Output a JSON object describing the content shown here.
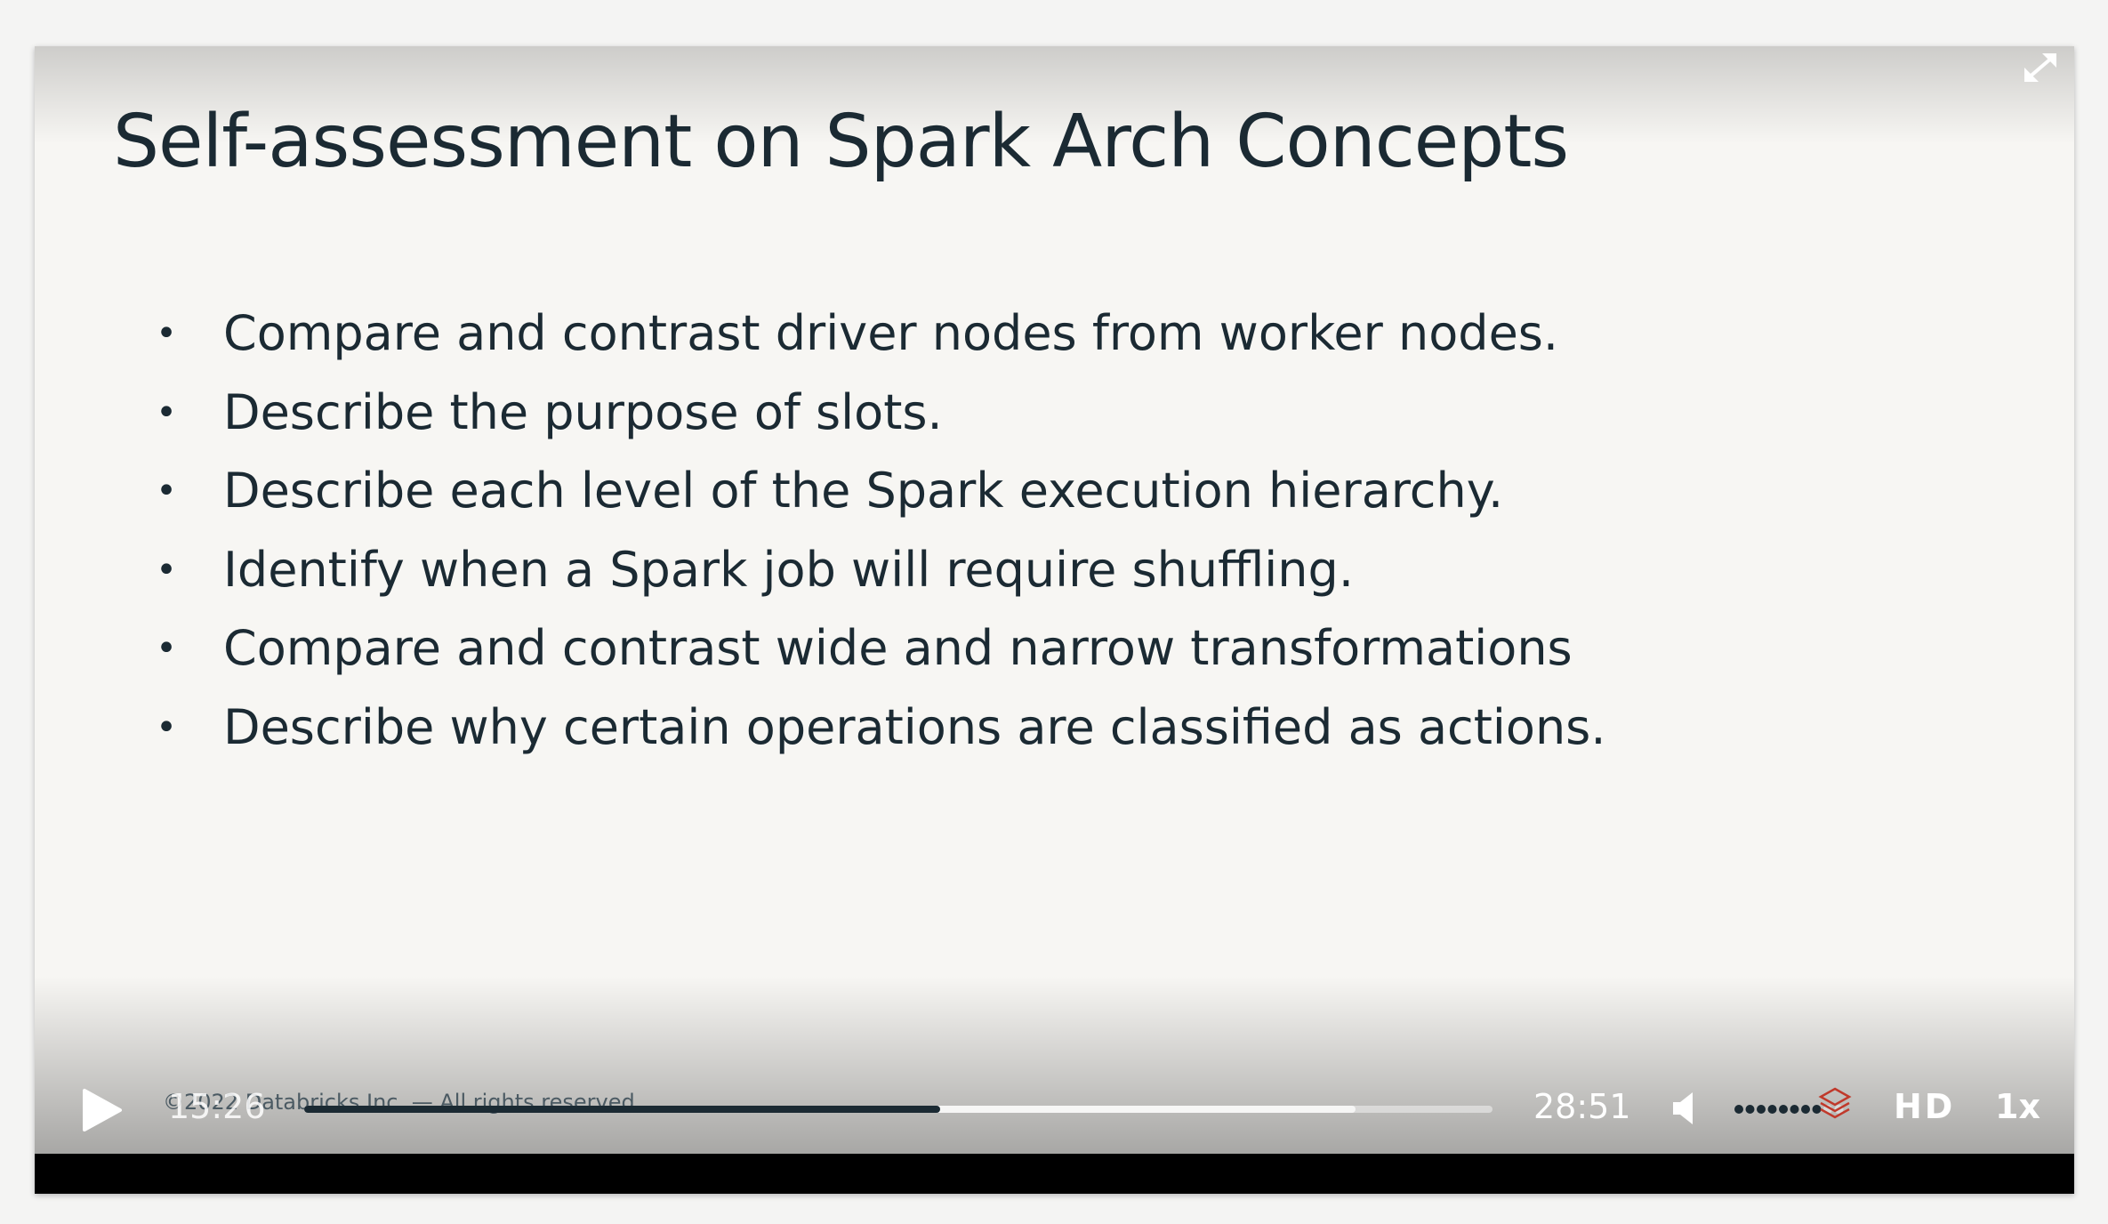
{
  "slide": {
    "title": "Self-assessment on Spark Arch Concepts",
    "bullet_glyph": "•",
    "bullets": [
      "Compare and contrast driver nodes from worker nodes.",
      "Describe the purpose of slots.",
      "Describe each level of the Spark execution hierarchy.",
      "Identify when a Spark job will require shuffling.",
      "Compare and contrast wide and narrow transformations",
      "Describe why certain operations are classified as actions."
    ],
    "footer": "©2022 Databricks Inc. — All rights reserved"
  },
  "player": {
    "current_time": "15:26",
    "total_time": "28:51",
    "played_fraction": 0.535,
    "buffered_fraction": 0.885,
    "volume_fraction": 0.8,
    "quality_label": "HD",
    "speed_label": "1x",
    "icons": {
      "play": "play-icon",
      "volume": "volume-icon",
      "corner": "expand-icon",
      "logo": "databricks-logo-icon"
    },
    "colors": {
      "played": "#1b2a33",
      "buffered": "#e6e6e6",
      "track": "#bdbdbd"
    }
  }
}
